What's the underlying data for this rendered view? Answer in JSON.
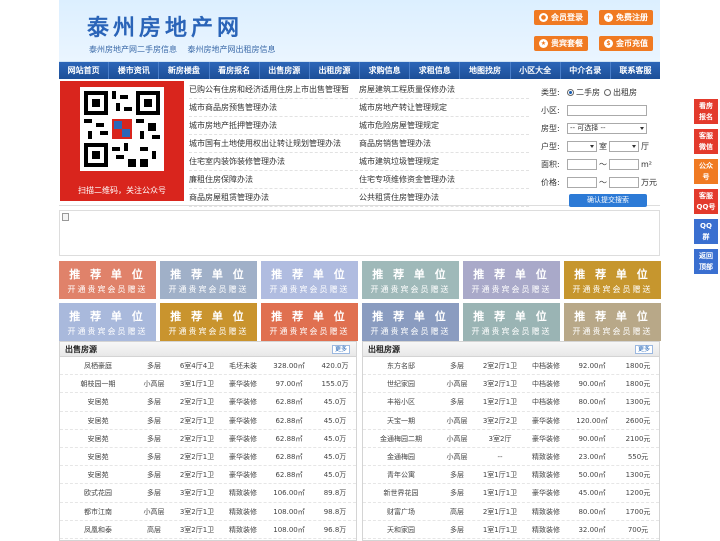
{
  "header": {
    "logo": "泰州房地产网",
    "sublink1": "泰州房地产网二手房信息",
    "sublink2": "泰州房地产网出租房信息",
    "buttons": [
      {
        "label": "会员登录"
      },
      {
        "label": "免费注册"
      },
      {
        "label": "贵宾套餐"
      },
      {
        "label": "金币充值"
      }
    ]
  },
  "nav": [
    "网站首页",
    "楼市资讯",
    "新房楼盘",
    "看房报名",
    "出售房源",
    "出租房源",
    "求购信息",
    "求租信息",
    "地图找房",
    "小区大全",
    "中介名录",
    "联系客服"
  ],
  "qr_caption": "扫描二维码，关注公众号",
  "news": [
    [
      "已购公有住房和经济适用住房上市出售管理暂",
      "房屋建筑工程质量保修办法"
    ],
    [
      "城市商品房预售管理办法",
      "城市房地产转让管理规定"
    ],
    [
      "城市房地产抵押管理办法",
      "城市危险房屋管理规定"
    ],
    [
      "城市国有土地使用权出让转让规划管理办法",
      "商品房销售管理办法"
    ],
    [
      "住宅室内装饰装修管理办法",
      "城市建筑垃圾管理规定"
    ],
    [
      "廉租住房保障办法",
      "住宅专项维修资金管理办法"
    ],
    [
      "商品房屋租赁管理办法",
      "公共租赁住房管理办法"
    ]
  ],
  "search": {
    "type_label": "类型:",
    "opt1": "二手房",
    "opt2": "出租房",
    "xiaoqu_label": "小区:",
    "fangxing_label": "房型:",
    "fangxing_value": "-- 可选择 --",
    "huxing_label": "户型:",
    "huxing_unit1": "室",
    "huxing_unit2": "厅",
    "area_label": "面积:",
    "area_sep": "～",
    "area_unit": "m²",
    "price_label": "价格:",
    "price_sep": "～",
    "price_unit": "万元",
    "submit": "确认提交搜索"
  },
  "tiles": {
    "title": "推 荐 单 位",
    "sub": "开通贵宾会员赠送",
    "colors": [
      "#e0826a",
      "#a0b0c8",
      "#b0bce0",
      "#9fb9b9",
      "#a9a9c9",
      "#c6962e",
      "#a9b9dc",
      "#c9942e",
      "#e07050",
      "#8a9cc0",
      "#9ab4b4",
      "#b8a888"
    ]
  },
  "sale": {
    "title": "出售房源",
    "more": "更多",
    "rows": [
      [
        "凤栖豪庭",
        "多层",
        "6室4厅4卫",
        "毛坯未装",
        "328.00㎡",
        "420.0万"
      ],
      [
        "朝枝园一期",
        "小高层",
        "3室1厅1卫",
        "豪华装修",
        "97.00㎡",
        "155.0万"
      ],
      [
        "安居苑",
        "多层",
        "2室2厅1卫",
        "豪华装修",
        "62.88㎡",
        "45.0万"
      ],
      [
        "安居苑",
        "多层",
        "2室2厅1卫",
        "豪华装修",
        "62.88㎡",
        "45.0万"
      ],
      [
        "安居苑",
        "多层",
        "2室2厅1卫",
        "豪华装修",
        "62.88㎡",
        "45.0万"
      ],
      [
        "安居苑",
        "多层",
        "2室2厅1卫",
        "豪华装修",
        "62.88㎡",
        "45.0万"
      ],
      [
        "安居苑",
        "多层",
        "2室2厅1卫",
        "豪华装修",
        "62.88㎡",
        "45.0万"
      ],
      [
        "欧式花园",
        "多层",
        "3室2厅1卫",
        "精致装修",
        "106.00㎡",
        "89.8万"
      ],
      [
        "都市江南",
        "小高层",
        "3室2厅1卫",
        "精致装修",
        "108.00㎡",
        "98.8万"
      ],
      [
        "凤凰和泰",
        "高层",
        "3室2厅1卫",
        "精致装修",
        "108.00㎡",
        "96.8万"
      ]
    ]
  },
  "rent": {
    "title": "出租房源",
    "more": "更多",
    "rows": [
      [
        "东方名邸",
        "多层",
        "2室2厅1卫",
        "中档装修",
        "92.00㎡",
        "1800元"
      ],
      [
        "世纪家园",
        "小高层",
        "3室2厅1卫",
        "中档装修",
        "90.00㎡",
        "1800元"
      ],
      [
        "丰裕小区",
        "多层",
        "1室2厅1卫",
        "中档装修",
        "80.00㎡",
        "1300元"
      ],
      [
        "天宝一期",
        "小高层",
        "3室2厅2卫",
        "豪华装修",
        "120.00㎡",
        "2600元"
      ],
      [
        "金通梅园二期",
        "小高层",
        "3室2厅",
        "豪华装修",
        "90.00㎡",
        "2100元"
      ],
      [
        "金通梅园",
        "小高层",
        "--",
        "精致装修",
        "23.00㎡",
        "550元"
      ],
      [
        "青年公寓",
        "多层",
        "1室1厅1卫",
        "精致装修",
        "50.00㎡",
        "1300元"
      ],
      [
        "新世界花园",
        "多层",
        "1室1厅1卫",
        "豪华装修",
        "45.00㎡",
        "1200元"
      ],
      [
        "财富广场",
        "高层",
        "2室1厅1卫",
        "精致装修",
        "80.00㎡",
        "1700元"
      ],
      [
        "天和家园",
        "多层",
        "1室1厅1卫",
        "精致装修",
        "32.00㎡",
        "700元"
      ]
    ]
  },
  "side": [
    {
      "l1": "看房",
      "l2": "报名"
    },
    {
      "l1": "客服",
      "l2": "微信"
    },
    {
      "l1": "公众",
      "l2": "号"
    },
    {
      "l1": "客服",
      "l2": "QQ号"
    },
    {
      "l1": "QQ",
      "l2": "群"
    },
    {
      "l1": "返回",
      "l2": "顶部"
    }
  ]
}
